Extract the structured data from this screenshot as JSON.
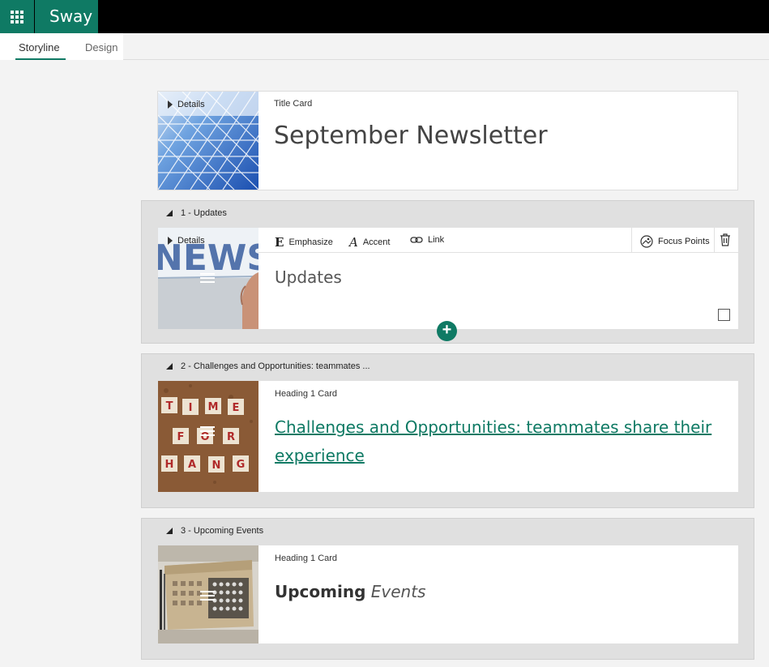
{
  "app": {
    "brand": "Sway",
    "icon": "waffle-icon"
  },
  "tabs": {
    "storyline": "Storyline",
    "design": "Design"
  },
  "title_card": {
    "details": "Details",
    "type_label": "Title Card",
    "title": "September Newsletter"
  },
  "sections": [
    {
      "header": "1 - Updates",
      "card": {
        "details": "Details",
        "toolbar": {
          "emphasize": "Emphasize",
          "accent": "Accent",
          "link": "Link",
          "focus_points": "Focus Points"
        },
        "heading": "Updates"
      }
    },
    {
      "header": "2 - Challenges and Opportunities: teammates ...",
      "card": {
        "type_label": "Heading 1 Card",
        "heading": "Challenges and Opportunities: teammates share their experience"
      }
    },
    {
      "header": "3 - Upcoming Events",
      "card": {
        "type_label": "Heading 1 Card",
        "heading_bold": "Upcoming",
        "heading_italic": "Events"
      }
    }
  ],
  "colors": {
    "accent": "#0f7a64",
    "topbar": "#000000"
  }
}
